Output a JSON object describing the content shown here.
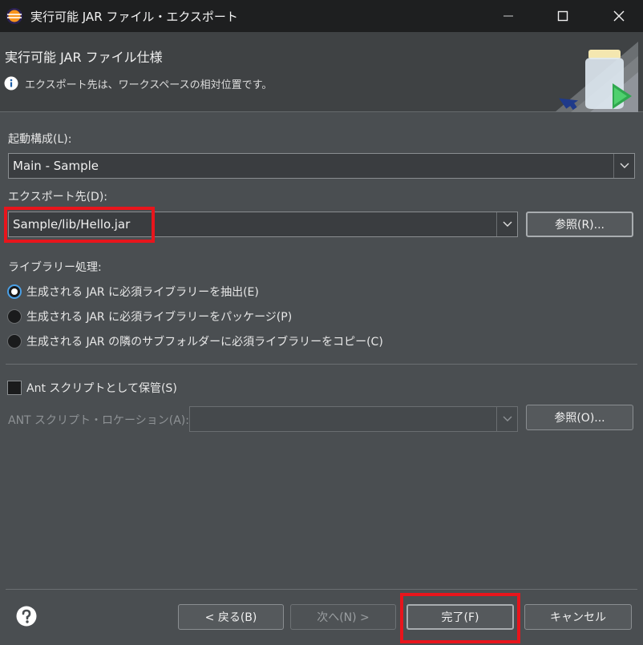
{
  "window": {
    "title": "実行可能 JAR ファイル・エクスポート",
    "minimize_icon": "minimize-icon",
    "maximize_icon": "maximize-icon",
    "close_icon": "close-icon"
  },
  "header": {
    "title": "実行可能 JAR ファイル仕様",
    "message": "エクスポート先は、ワークスペースの相対位置です。",
    "info_icon": "info-icon",
    "graphic_icon": "jar-export-graphic-icon"
  },
  "launch_config": {
    "label": "起動構成(L):",
    "value": "Main - Sample"
  },
  "export_dest": {
    "label": "エクスポート先(D):",
    "value": "Sample/lib/Hello.jar",
    "browse_label": "参照(R)..."
  },
  "library_handling": {
    "label": "ライブラリー処理:",
    "options": [
      {
        "label": "生成される JAR に必須ライブラリーを抽出(E)",
        "selected": true
      },
      {
        "label": "生成される JAR に必須ライブラリーをパッケージ(P)",
        "selected": false
      },
      {
        "label": "生成される JAR の隣のサブフォルダーに必須ライブラリーをコピー(C)",
        "selected": false
      }
    ]
  },
  "ant": {
    "checkbox_label": "Ant スクリプトとして保管(S)",
    "checked": false,
    "location_label": "ANT スクリプト・ロケーション(A):",
    "location_value": "",
    "browse_label": "参照(O)..."
  },
  "footer": {
    "help_icon": "help-icon",
    "back_label": "< 戻る(B)",
    "next_label": "次へ(N) >",
    "finish_label": "完了(F)",
    "cancel_label": "キャンセル"
  },
  "colors": {
    "background": "#4a4e51",
    "titlebar": "#1e1f20",
    "highlight": "#e8151c",
    "radio_accent": "#4aa0e6"
  }
}
